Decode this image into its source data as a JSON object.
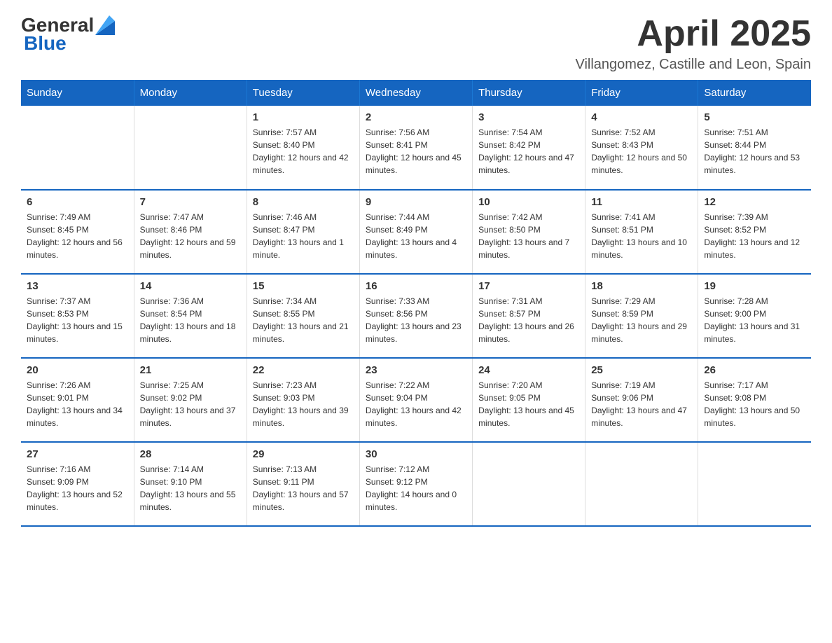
{
  "header": {
    "logo_general": "General",
    "logo_blue": "Blue",
    "month": "April 2025",
    "location": "Villangomez, Castille and Leon, Spain"
  },
  "weekdays": [
    "Sunday",
    "Monday",
    "Tuesday",
    "Wednesday",
    "Thursday",
    "Friday",
    "Saturday"
  ],
  "weeks": [
    [
      {
        "day": "",
        "sunrise": "",
        "sunset": "",
        "daylight": ""
      },
      {
        "day": "",
        "sunrise": "",
        "sunset": "",
        "daylight": ""
      },
      {
        "day": "1",
        "sunrise": "Sunrise: 7:57 AM",
        "sunset": "Sunset: 8:40 PM",
        "daylight": "Daylight: 12 hours and 42 minutes."
      },
      {
        "day": "2",
        "sunrise": "Sunrise: 7:56 AM",
        "sunset": "Sunset: 8:41 PM",
        "daylight": "Daylight: 12 hours and 45 minutes."
      },
      {
        "day": "3",
        "sunrise": "Sunrise: 7:54 AM",
        "sunset": "Sunset: 8:42 PM",
        "daylight": "Daylight: 12 hours and 47 minutes."
      },
      {
        "day": "4",
        "sunrise": "Sunrise: 7:52 AM",
        "sunset": "Sunset: 8:43 PM",
        "daylight": "Daylight: 12 hours and 50 minutes."
      },
      {
        "day": "5",
        "sunrise": "Sunrise: 7:51 AM",
        "sunset": "Sunset: 8:44 PM",
        "daylight": "Daylight: 12 hours and 53 minutes."
      }
    ],
    [
      {
        "day": "6",
        "sunrise": "Sunrise: 7:49 AM",
        "sunset": "Sunset: 8:45 PM",
        "daylight": "Daylight: 12 hours and 56 minutes."
      },
      {
        "day": "7",
        "sunrise": "Sunrise: 7:47 AM",
        "sunset": "Sunset: 8:46 PM",
        "daylight": "Daylight: 12 hours and 59 minutes."
      },
      {
        "day": "8",
        "sunrise": "Sunrise: 7:46 AM",
        "sunset": "Sunset: 8:47 PM",
        "daylight": "Daylight: 13 hours and 1 minute."
      },
      {
        "day": "9",
        "sunrise": "Sunrise: 7:44 AM",
        "sunset": "Sunset: 8:49 PM",
        "daylight": "Daylight: 13 hours and 4 minutes."
      },
      {
        "day": "10",
        "sunrise": "Sunrise: 7:42 AM",
        "sunset": "Sunset: 8:50 PM",
        "daylight": "Daylight: 13 hours and 7 minutes."
      },
      {
        "day": "11",
        "sunrise": "Sunrise: 7:41 AM",
        "sunset": "Sunset: 8:51 PM",
        "daylight": "Daylight: 13 hours and 10 minutes."
      },
      {
        "day": "12",
        "sunrise": "Sunrise: 7:39 AM",
        "sunset": "Sunset: 8:52 PM",
        "daylight": "Daylight: 13 hours and 12 minutes."
      }
    ],
    [
      {
        "day": "13",
        "sunrise": "Sunrise: 7:37 AM",
        "sunset": "Sunset: 8:53 PM",
        "daylight": "Daylight: 13 hours and 15 minutes."
      },
      {
        "day": "14",
        "sunrise": "Sunrise: 7:36 AM",
        "sunset": "Sunset: 8:54 PM",
        "daylight": "Daylight: 13 hours and 18 minutes."
      },
      {
        "day": "15",
        "sunrise": "Sunrise: 7:34 AM",
        "sunset": "Sunset: 8:55 PM",
        "daylight": "Daylight: 13 hours and 21 minutes."
      },
      {
        "day": "16",
        "sunrise": "Sunrise: 7:33 AM",
        "sunset": "Sunset: 8:56 PM",
        "daylight": "Daylight: 13 hours and 23 minutes."
      },
      {
        "day": "17",
        "sunrise": "Sunrise: 7:31 AM",
        "sunset": "Sunset: 8:57 PM",
        "daylight": "Daylight: 13 hours and 26 minutes."
      },
      {
        "day": "18",
        "sunrise": "Sunrise: 7:29 AM",
        "sunset": "Sunset: 8:59 PM",
        "daylight": "Daylight: 13 hours and 29 minutes."
      },
      {
        "day": "19",
        "sunrise": "Sunrise: 7:28 AM",
        "sunset": "Sunset: 9:00 PM",
        "daylight": "Daylight: 13 hours and 31 minutes."
      }
    ],
    [
      {
        "day": "20",
        "sunrise": "Sunrise: 7:26 AM",
        "sunset": "Sunset: 9:01 PM",
        "daylight": "Daylight: 13 hours and 34 minutes."
      },
      {
        "day": "21",
        "sunrise": "Sunrise: 7:25 AM",
        "sunset": "Sunset: 9:02 PM",
        "daylight": "Daylight: 13 hours and 37 minutes."
      },
      {
        "day": "22",
        "sunrise": "Sunrise: 7:23 AM",
        "sunset": "Sunset: 9:03 PM",
        "daylight": "Daylight: 13 hours and 39 minutes."
      },
      {
        "day": "23",
        "sunrise": "Sunrise: 7:22 AM",
        "sunset": "Sunset: 9:04 PM",
        "daylight": "Daylight: 13 hours and 42 minutes."
      },
      {
        "day": "24",
        "sunrise": "Sunrise: 7:20 AM",
        "sunset": "Sunset: 9:05 PM",
        "daylight": "Daylight: 13 hours and 45 minutes."
      },
      {
        "day": "25",
        "sunrise": "Sunrise: 7:19 AM",
        "sunset": "Sunset: 9:06 PM",
        "daylight": "Daylight: 13 hours and 47 minutes."
      },
      {
        "day": "26",
        "sunrise": "Sunrise: 7:17 AM",
        "sunset": "Sunset: 9:08 PM",
        "daylight": "Daylight: 13 hours and 50 minutes."
      }
    ],
    [
      {
        "day": "27",
        "sunrise": "Sunrise: 7:16 AM",
        "sunset": "Sunset: 9:09 PM",
        "daylight": "Daylight: 13 hours and 52 minutes."
      },
      {
        "day": "28",
        "sunrise": "Sunrise: 7:14 AM",
        "sunset": "Sunset: 9:10 PM",
        "daylight": "Daylight: 13 hours and 55 minutes."
      },
      {
        "day": "29",
        "sunrise": "Sunrise: 7:13 AM",
        "sunset": "Sunset: 9:11 PM",
        "daylight": "Daylight: 13 hours and 57 minutes."
      },
      {
        "day": "30",
        "sunrise": "Sunrise: 7:12 AM",
        "sunset": "Sunset: 9:12 PM",
        "daylight": "Daylight: 14 hours and 0 minutes."
      },
      {
        "day": "",
        "sunrise": "",
        "sunset": "",
        "daylight": ""
      },
      {
        "day": "",
        "sunrise": "",
        "sunset": "",
        "daylight": ""
      },
      {
        "day": "",
        "sunrise": "",
        "sunset": "",
        "daylight": ""
      }
    ]
  ]
}
